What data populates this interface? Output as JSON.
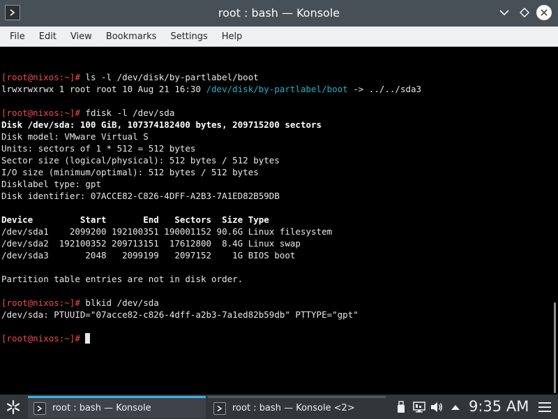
{
  "window": {
    "title": "root : bash — Konsole"
  },
  "menu": [
    "File",
    "Edit",
    "View",
    "Bookmarks",
    "Settings",
    "Help"
  ],
  "terminal": {
    "lines": [
      {
        "parts": []
      },
      {
        "parts": [
          {
            "t": "[root@nixos:~]#",
            "c": "prompt"
          },
          {
            "t": " ls -l /dev/disk/by-partlabel/boot",
            "c": ""
          }
        ]
      },
      {
        "parts": [
          {
            "t": "lrwxrwxrwx 1 root root 10 Aug 21 16:30 ",
            "c": ""
          },
          {
            "t": "/dev/disk/by-partlabel/boot",
            "c": "path"
          },
          {
            "t": " -> ../../sda3",
            "c": ""
          }
        ]
      },
      {
        "parts": []
      },
      {
        "parts": [
          {
            "t": "[root@nixos:~]#",
            "c": "prompt"
          },
          {
            "t": " fdisk -l /dev/sda",
            "c": ""
          }
        ]
      },
      {
        "parts": [
          {
            "t": "Disk /dev/sda: 100 GiB, 107374182400 bytes, 209715200 sectors",
            "c": "bold"
          }
        ]
      },
      {
        "parts": [
          {
            "t": "Disk model: VMware Virtual S",
            "c": ""
          }
        ]
      },
      {
        "parts": [
          {
            "t": "Units: sectors of 1 * 512 = 512 bytes",
            "c": ""
          }
        ]
      },
      {
        "parts": [
          {
            "t": "Sector size (logical/physical): 512 bytes / 512 bytes",
            "c": ""
          }
        ]
      },
      {
        "parts": [
          {
            "t": "I/O size (minimum/optimal): 512 bytes / 512 bytes",
            "c": ""
          }
        ]
      },
      {
        "parts": [
          {
            "t": "Disklabel type: gpt",
            "c": ""
          }
        ]
      },
      {
        "parts": [
          {
            "t": "Disk identifier: 07ACCE82-C826-4DFF-A2B3-7A1ED82B59DB",
            "c": ""
          }
        ]
      },
      {
        "parts": []
      },
      {
        "parts": [
          {
            "t": "Device         Start       End   Sectors  Size Type",
            "c": "bold"
          }
        ]
      },
      {
        "parts": [
          {
            "t": "/dev/sda1    2099200 192100351 190001152 90.6G Linux filesystem",
            "c": ""
          }
        ]
      },
      {
        "parts": [
          {
            "t": "/dev/sda2  192100352 209713151  17612800  8.4G Linux swap",
            "c": ""
          }
        ]
      },
      {
        "parts": [
          {
            "t": "/dev/sda3       2048   2099199   2097152    1G BIOS boot",
            "c": ""
          }
        ]
      },
      {
        "parts": []
      },
      {
        "parts": [
          {
            "t": "Partition table entries are not in disk order.",
            "c": ""
          }
        ]
      },
      {
        "parts": []
      },
      {
        "parts": [
          {
            "t": "[root@nixos:~]#",
            "c": "prompt"
          },
          {
            "t": " blkid /dev/sda",
            "c": ""
          }
        ]
      },
      {
        "parts": [
          {
            "t": "/dev/sda: PTUUID=\"07acce82-c826-4dff-a2b3-7a1ed82b59db\" PTTYPE=\"gpt\"",
            "c": ""
          }
        ]
      },
      {
        "parts": []
      },
      {
        "parts": [
          {
            "t": "[root@nixos:~]#",
            "c": "prompt"
          },
          {
            "t": " ",
            "c": ""
          }
        ],
        "cursor": true
      }
    ]
  },
  "taskbar": {
    "tasks": [
      {
        "label": "root : bash — Konsole",
        "active": true
      },
      {
        "label": "root : bash — Konsole <2>",
        "active": false
      }
    ],
    "clock": "9:35 AM"
  },
  "colors": {
    "prompt": "#f24b4b",
    "path": "#1bb5c6",
    "accent": "#3daee9"
  }
}
